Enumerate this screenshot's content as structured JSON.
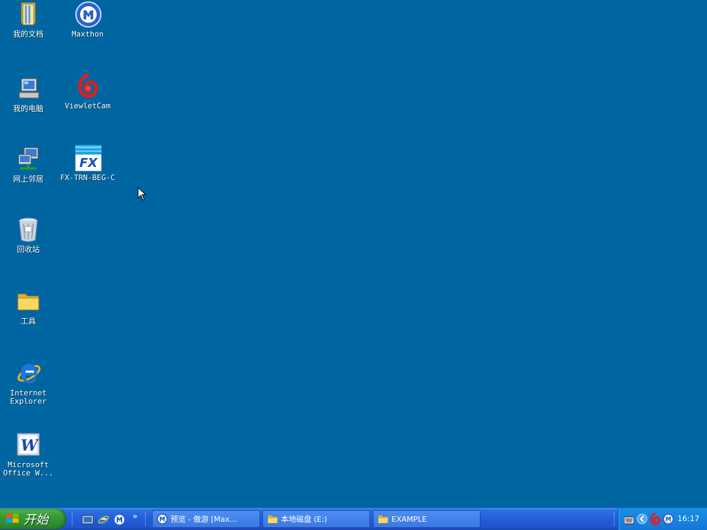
{
  "desktop": {
    "icons": [
      {
        "label": "我的文档"
      },
      {
        "label": "Maxthon"
      },
      {
        "label": "我的电脑"
      },
      {
        "label": "ViewletCam"
      },
      {
        "label": "网上邻居"
      },
      {
        "label": "FX-TRN-BEG-C"
      },
      {
        "label": "回收站"
      },
      {
        "label": "工具"
      },
      {
        "label": "Internet\nExplorer"
      },
      {
        "label": "Microsoft\nOffice W..."
      }
    ]
  },
  "taskbar": {
    "start_label": "开始",
    "quicklaunch_overflow": "»",
    "tasks": [
      {
        "label": "预览 - 傲游 [Max..."
      },
      {
        "label": "本地磁盘 (E:)"
      },
      {
        "label": "EXAMPLE"
      }
    ],
    "clock": "16:17"
  },
  "colors": {
    "desktop": "#0066a2",
    "taskbar": "#245edb",
    "start_button": "#3c9e3c",
    "tray": "#1478d8"
  }
}
